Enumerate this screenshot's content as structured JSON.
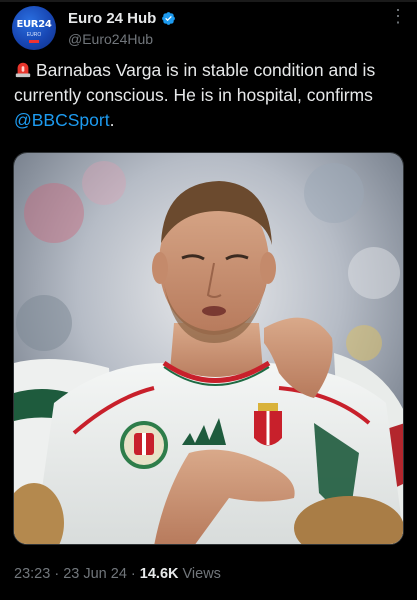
{
  "author": {
    "name": "Euro 24 Hub",
    "handle": "@Euro24Hub",
    "avatar_text": "EUR​24",
    "avatar_sub": "EURO"
  },
  "tweet": {
    "siren_icon": "rotating-light-emoji",
    "text_before": "Barnabas Varga is in stable condition and is currently conscious. He is in hospital, confirms ",
    "mention": "@BBCSport",
    "text_after": "."
  },
  "meta": {
    "time": "23:23",
    "separator": " · ",
    "date": "23 Jun 24",
    "separator2": " · ",
    "views_count": "14.6K",
    "views_label": " Views"
  },
  "colors": {
    "background": "#000000",
    "text": "#e7e9ea",
    "secondary": "#71767b",
    "accent": "#1d9bf0"
  }
}
